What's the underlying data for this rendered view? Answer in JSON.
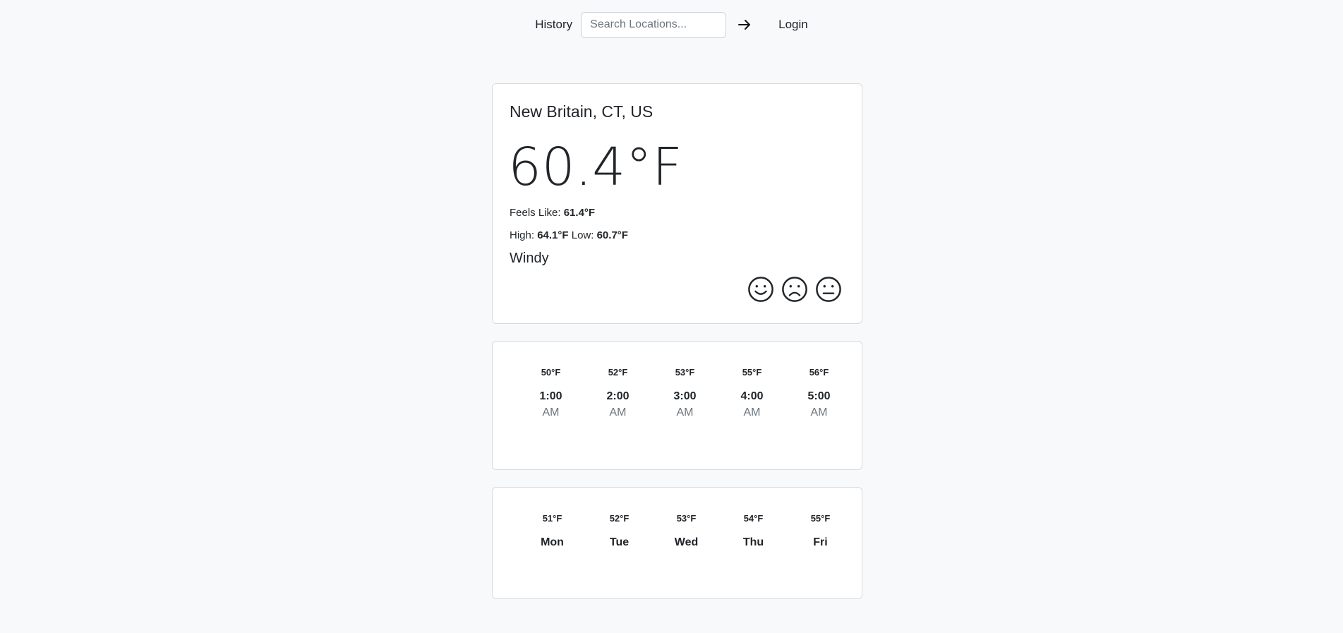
{
  "nav": {
    "history_label": "History",
    "search_placeholder": "Search Locations...",
    "login_label": "Login"
  },
  "current": {
    "location": "New Britain, CT, US",
    "temperature": "60.4°F",
    "feels_like_label": "Feels Like:",
    "feels_like_value": "61.4°F",
    "high_label": "High:",
    "high_value": "64.1°F",
    "low_label": "Low:",
    "low_value": "60.7°F",
    "condition": "Windy"
  },
  "hourly": [
    {
      "temp": "50°F",
      "time": "1:00",
      "ampm": "AM"
    },
    {
      "temp": "52°F",
      "time": "2:00",
      "ampm": "AM"
    },
    {
      "temp": "53°F",
      "time": "3:00",
      "ampm": "AM"
    },
    {
      "temp": "55°F",
      "time": "4:00",
      "ampm": "AM"
    },
    {
      "temp": "56°F",
      "time": "5:00",
      "ampm": "AM"
    }
  ],
  "daily": [
    {
      "temp": "51°F",
      "day": "Mon"
    },
    {
      "temp": "52°F",
      "day": "Tue"
    },
    {
      "temp": "53°F",
      "day": "Wed"
    },
    {
      "temp": "54°F",
      "day": "Thu"
    },
    {
      "temp": "55°F",
      "day": "Fri"
    }
  ],
  "icons": {
    "arrow": "arrow-right-icon",
    "faces": [
      "smile-icon",
      "frown-icon",
      "neutral-face-icon"
    ]
  }
}
